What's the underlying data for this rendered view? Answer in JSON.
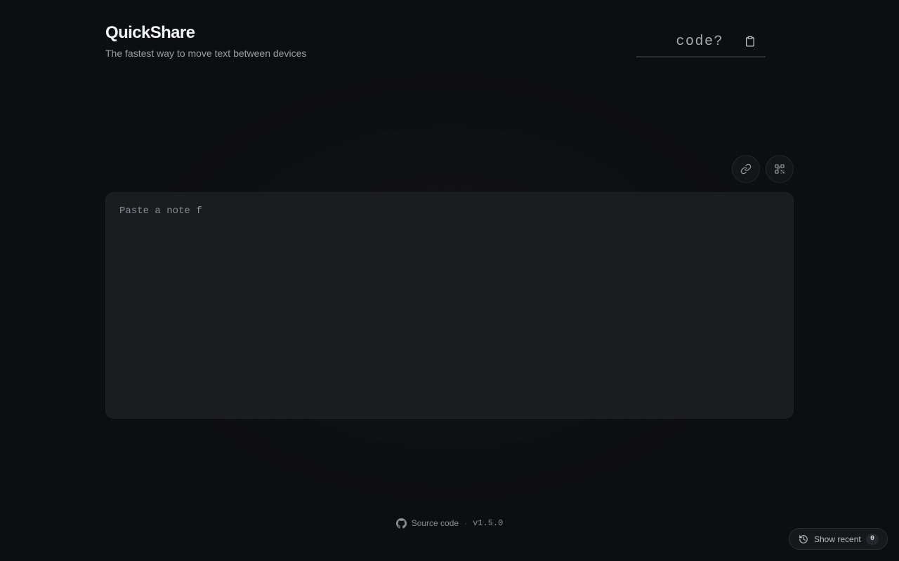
{
  "header": {
    "title": "QuickShare",
    "subtitle": "The fastest way to move text between devices"
  },
  "code_entry": {
    "placeholder": "code?",
    "value": "",
    "paste_icon": "clipboard-icon"
  },
  "actions": {
    "link_icon": "link-icon",
    "qr_icon": "qr-code-icon"
  },
  "note": {
    "placeholder": "Paste a note f",
    "value": ""
  },
  "footer": {
    "source_label": "Source code",
    "separator": "·",
    "version": "v1.5.0",
    "source_icon": "github-icon"
  },
  "recent": {
    "label": "Show recent",
    "count": "0",
    "icon": "history-icon"
  },
  "colors": {
    "background": "#0d0e10",
    "panel": "#1a1c20",
    "text_primary": "#f2f3f5",
    "text_muted": "#9a9ea6"
  }
}
